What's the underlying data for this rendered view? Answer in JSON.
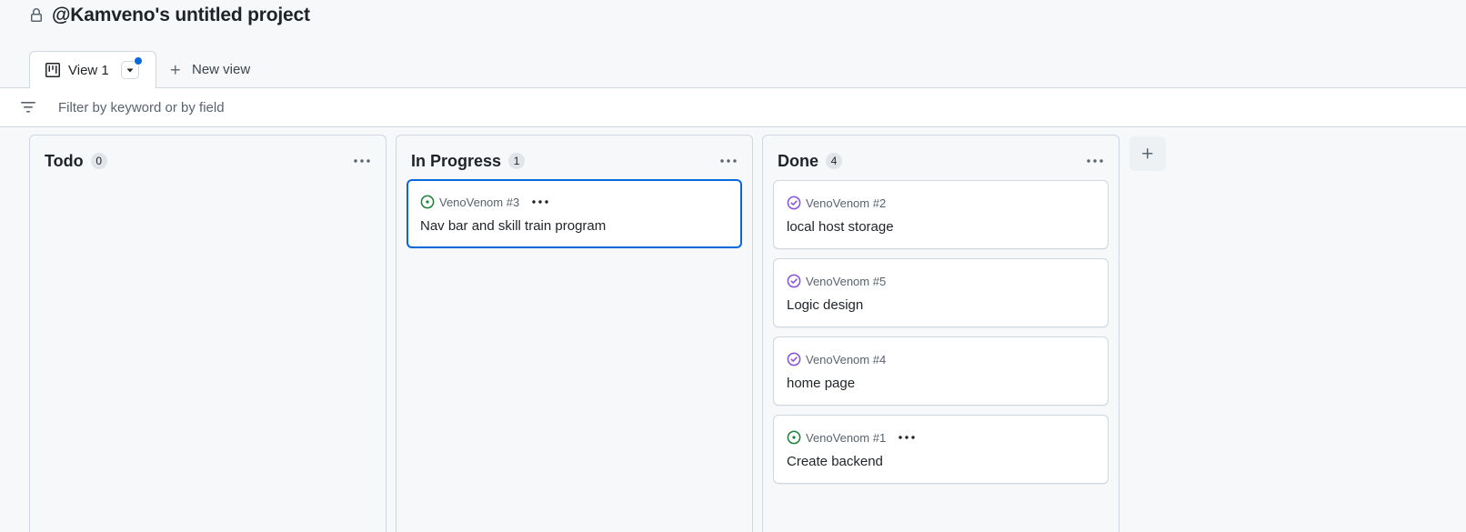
{
  "project": {
    "title": "@Kamveno's untitled project"
  },
  "tabs": {
    "active_label": "View 1",
    "new_view_label": "New view"
  },
  "filter": {
    "placeholder": "Filter by keyword or by field",
    "value": ""
  },
  "columns": [
    {
      "title": "Todo",
      "count": "0",
      "cards": []
    },
    {
      "title": "In Progress",
      "count": "1",
      "cards": [
        {
          "ref": "VenoVenom #3",
          "title": "Nav bar and skill train program",
          "status": "open"
        }
      ]
    },
    {
      "title": "Done",
      "count": "4",
      "cards": [
        {
          "ref": "VenoVenom #2",
          "title": "local host storage",
          "status": "completed"
        },
        {
          "ref": "VenoVenom #5",
          "title": "Logic design",
          "status": "completed"
        },
        {
          "ref": "VenoVenom #4",
          "title": "home page",
          "status": "completed"
        },
        {
          "ref": "VenoVenom #1",
          "title": "Create backend",
          "status": "open"
        }
      ]
    }
  ],
  "icons": {
    "lock": "lock-icon",
    "board": "project-board-icon",
    "caret": "triangle-down-icon",
    "plus": "plus-icon",
    "filter": "filter-icon",
    "kebab": "kebab-horizontal-icon",
    "issue_open": "issue-open-icon",
    "issue_completed": "issue-closed-icon"
  },
  "colors": {
    "accent": "#0969da",
    "open": "#1a7f37",
    "completed": "#8250df",
    "border": "#d0d7de",
    "canvas": "#f6f8fa"
  }
}
